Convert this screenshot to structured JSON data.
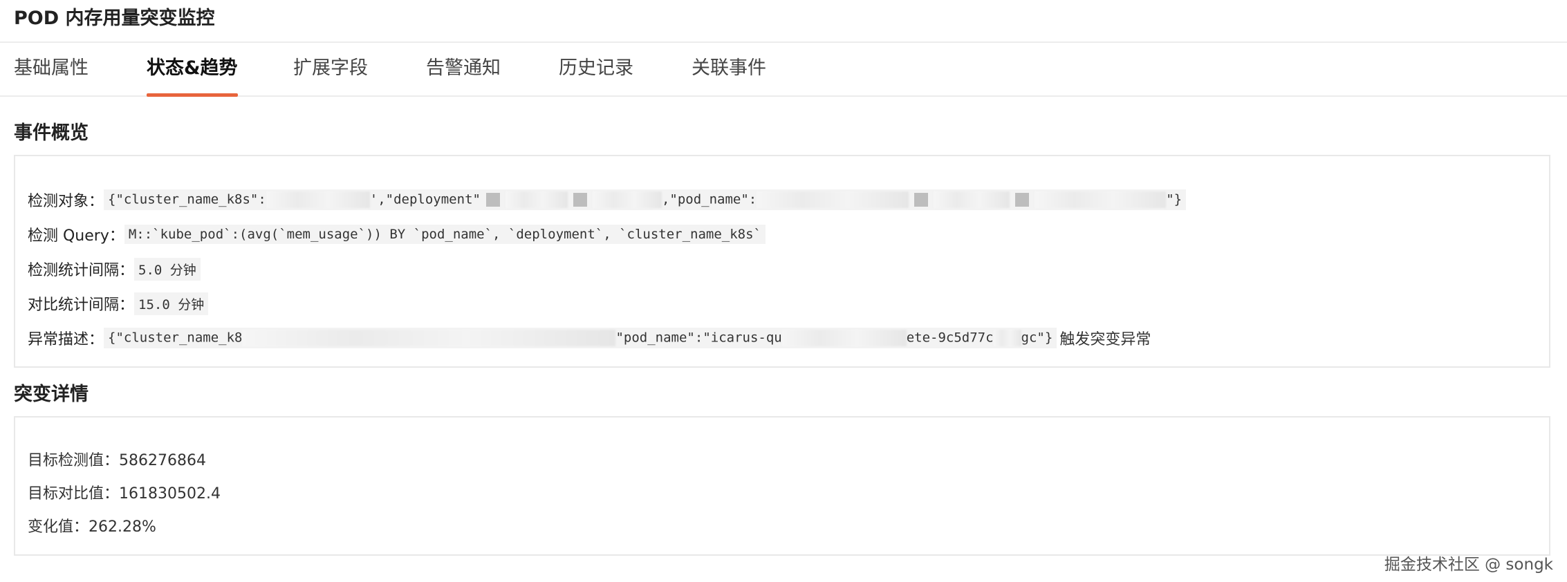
{
  "header": {
    "title": "POD 内存用量突变监控"
  },
  "tabs": [
    {
      "label": "基础属性",
      "active": false
    },
    {
      "label": "状态&趋势",
      "active": true
    },
    {
      "label": "扩展字段",
      "active": false
    },
    {
      "label": "告警通知",
      "active": false
    },
    {
      "label": "历史记录",
      "active": false
    },
    {
      "label": "关联事件",
      "active": false
    }
  ],
  "overview": {
    "title": "事件概览",
    "target_label": "检测对象：",
    "target_value_part1": "{\"cluster_name_k8s\":",
    "target_value_part2": "',\"deployment\"",
    "target_value_part3": ",\"pod_name\":",
    "target_value_part4": "\"}",
    "query_label": "检测 Query：",
    "query_value": "M::`kube_pod`:(avg(`mem_usage`)) BY `pod_name`, `deployment`, `cluster_name_k8s`",
    "interval_label": "检测统计间隔：",
    "interval_value": "5.0 分钟",
    "compare_label": "对比统计间隔：",
    "compare_value": " 15.0 分钟",
    "anomaly_label": "异常描述：",
    "anomaly_value_part1": "{\"cluster_name_k8",
    "anomaly_value_part2": "\"pod_name\":\"icarus-qu",
    "anomaly_value_part3": "ete-9c5d77c",
    "anomaly_value_part4": "gc\"}",
    "anomaly_suffix": "触发突变异常"
  },
  "details": {
    "title": "突变详情",
    "target_value_label": "目标检测值：",
    "target_value": "586276864",
    "compare_value_label": "目标对比值：",
    "compare_value": "161830502.4",
    "change_label": "变化值：",
    "change_value": "262.28%"
  },
  "watermark": "掘金技术社区 @ songk",
  "colors": {
    "accent": "#e8643c"
  }
}
